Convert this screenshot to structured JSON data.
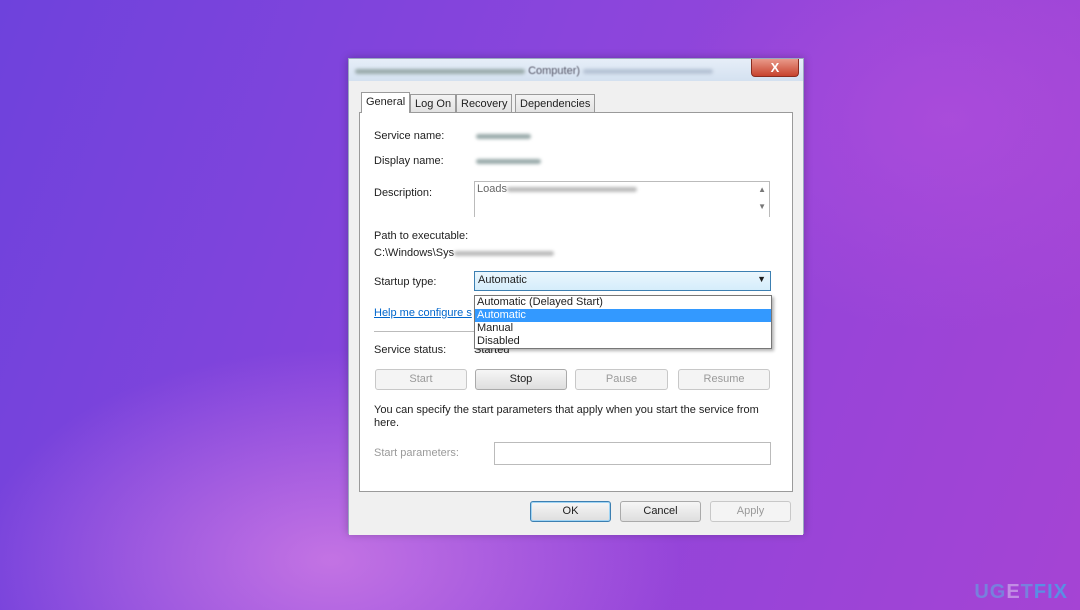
{
  "window": {
    "title_partial": "Computer)",
    "close_label": "X"
  },
  "tabs": [
    {
      "label": "General",
      "active": true
    },
    {
      "label": "Log On"
    },
    {
      "label": "Recovery"
    },
    {
      "label": "Dependencies"
    }
  ],
  "general": {
    "service_name_label": "Service name:",
    "display_name_label": "Display name:",
    "description_label": "Description:",
    "description_value_partial": "Loads",
    "path_label": "Path to executable:",
    "path_value_partial": "C:\\Windows\\Sys",
    "startup_type_label": "Startup type:",
    "startup_type_value": "Automatic",
    "startup_options": [
      "Automatic (Delayed Start)",
      "Automatic",
      "Manual",
      "Disabled"
    ],
    "highlighted_option": "Automatic",
    "help_link": "Help me configure s",
    "service_status_label": "Service status:",
    "service_status_value": "Started",
    "buttons": {
      "start": "Start",
      "stop": "Stop",
      "pause": "Pause",
      "resume": "Resume"
    },
    "params_note": "You can specify the start parameters that apply when you start the service from here.",
    "start_params_label": "Start parameters:",
    "start_params_value": ""
  },
  "footer": {
    "ok": "OK",
    "cancel": "Cancel",
    "apply": "Apply"
  },
  "watermark": {
    "text": "UGETFIX"
  },
  "colors": {
    "highlight": "#3399ff",
    "close": "#c7432e",
    "link": "#0066cc"
  }
}
